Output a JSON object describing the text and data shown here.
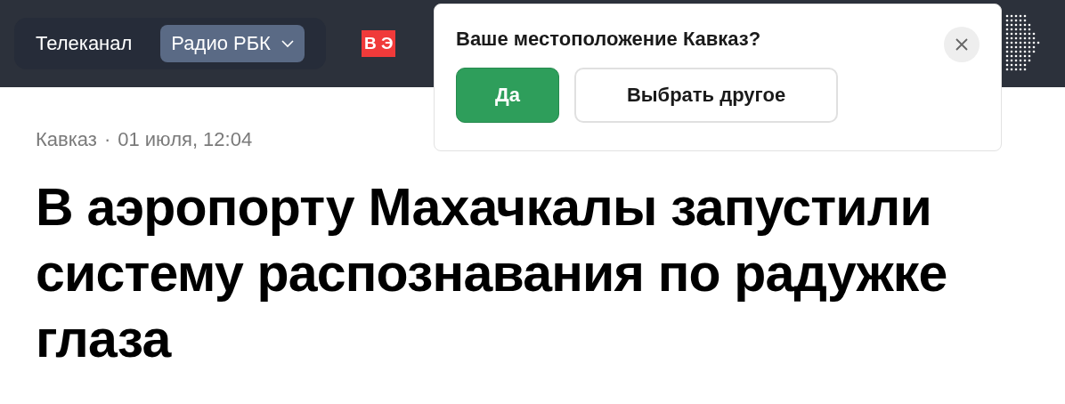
{
  "header": {
    "tabs": [
      {
        "label": "Телеканал",
        "selected": false
      },
      {
        "label": "Радио РБК",
        "selected": true
      }
    ],
    "live_badge": "В Э"
  },
  "location_popup": {
    "question": "Ваше местоположение Кавказ?",
    "confirm": "Да",
    "other": "Выбрать другое"
  },
  "article": {
    "region": "Кавказ",
    "separator": "·",
    "date": "01 июля, 12:04",
    "title": "В аэропорту Махачкалы запустили систему распознавания по радужке глаза"
  }
}
